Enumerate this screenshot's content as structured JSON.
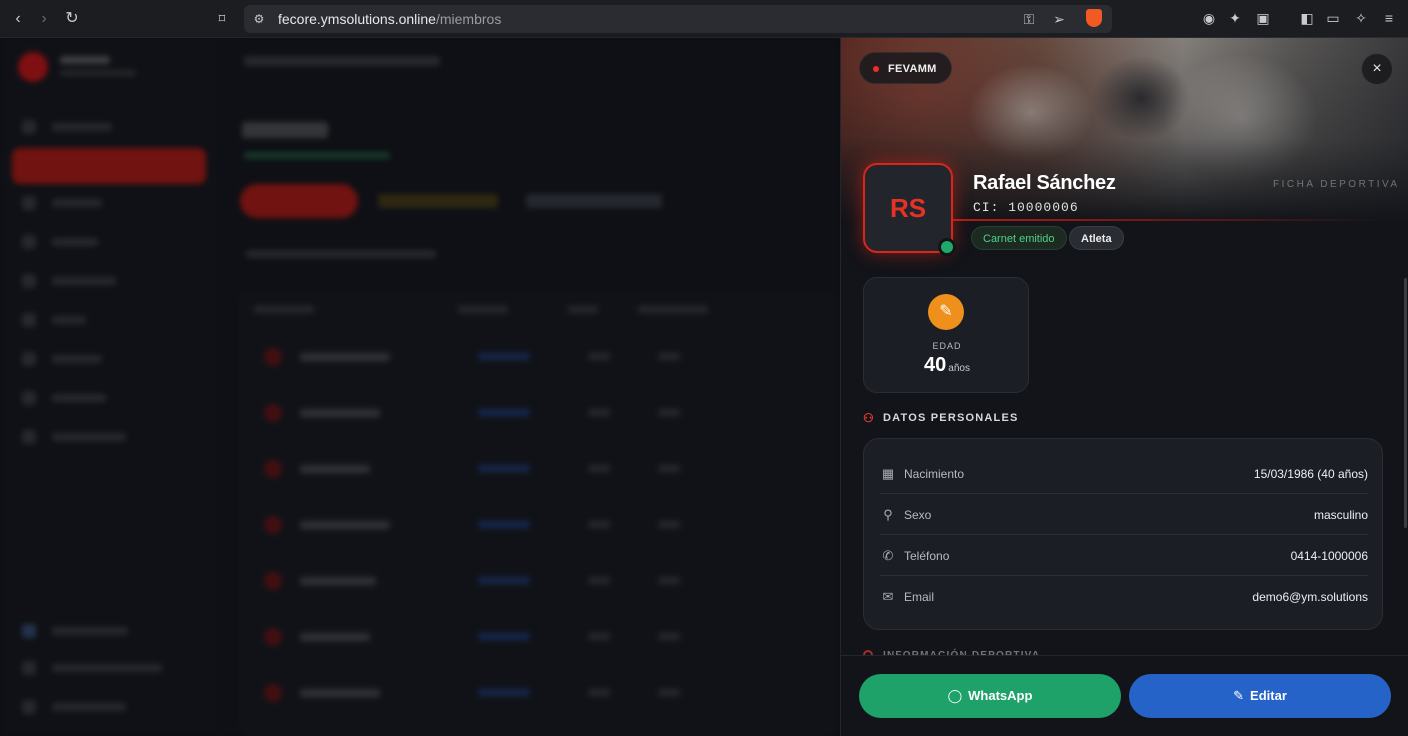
{
  "browser": {
    "url_domain": "fecore.ymsolutions.online",
    "url_path": "/miembros"
  },
  "panel": {
    "org_badge": "FEVAMM",
    "ficha_label": "FICHA DEPORTIVA",
    "close_symbol": "×",
    "avatar_initials": "RS",
    "name": "Rafael Sánchez",
    "ci": "CI: 10000006",
    "chips": {
      "carnet": "Carnet emitido",
      "role": "Atleta"
    },
    "age_stat": {
      "label": "EDAD",
      "value": "40",
      "unit": "años"
    },
    "personal_section_title": "DATOS PERSONALES",
    "personal": [
      {
        "icon": "calendar-icon",
        "key": "Nacimiento",
        "value": "15/03/1986 (40 años)"
      },
      {
        "icon": "person-icon",
        "key": "Sexo",
        "value": "masculino"
      },
      {
        "icon": "phone-icon",
        "key": "Teléfono",
        "value": "0414-1000006"
      },
      {
        "icon": "mail-icon",
        "key": "Email",
        "value": "demo6@ym.solutions"
      }
    ],
    "sport_section_title": "INFORMACIÓN DEPORTIVA",
    "actions": {
      "whatsapp": "WhatsApp",
      "edit": "Editar"
    }
  },
  "colors": {
    "accent_red": "#d8261b",
    "online_green": "#1faa6a",
    "whatsapp_green": "#1fa26a",
    "edit_blue": "#2563c9",
    "age_orange": "#f0901c"
  }
}
